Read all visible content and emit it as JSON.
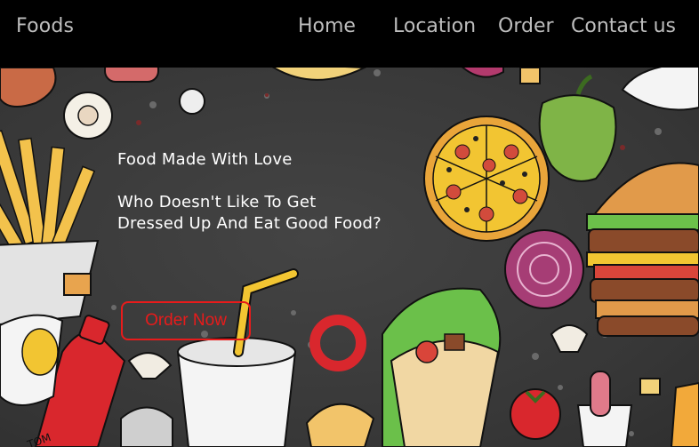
{
  "header": {
    "brand": "Foods",
    "nav": [
      "Home",
      "Location",
      "Order",
      "Contact us"
    ]
  },
  "hero": {
    "line1": "Food Made With Love",
    "line2": "Who Doesn't Like To Get",
    "line3": "Dressed Up And Eat Good Food?",
    "cta_label": "Order Now",
    "ketchup_label": "TOM"
  },
  "colors": {
    "header_bg": "#000000",
    "hero_bg": "#3a3a3a",
    "text": "#ffffff",
    "accent": "#e81b1b"
  }
}
